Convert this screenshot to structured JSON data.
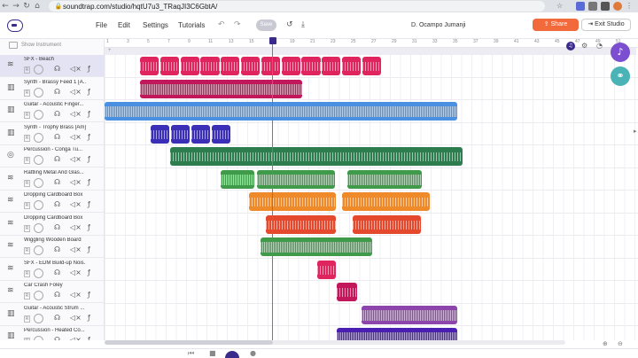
{
  "browser": {
    "url_host": "soundtrap.com",
    "url_path": "/studio/hqtU7u3_TRaqJI3C6GbtA/"
  },
  "header": {
    "menu": [
      "File",
      "Edit",
      "Settings",
      "Tutorials"
    ],
    "save_label": "Save",
    "user_name": "D. Ocampo Jumanji",
    "share_label": "Share",
    "exit_label": "Exit Studio"
  },
  "sidebar": {
    "show_instrument": "Show Instrument",
    "tracks": [
      {
        "name": "SFX - Beach",
        "icon": "waveform-icon"
      },
      {
        "name": "Synth - Brassy Feed 1 [A...",
        "icon": "keyboard-icon"
      },
      {
        "name": "Guitar - Acoustic Finger...",
        "icon": "keyboard-icon"
      },
      {
        "name": "Synth - Trophy Brass [Am]",
        "icon": "keyboard-icon"
      },
      {
        "name": "Percussion - Conga Tu...",
        "icon": "drum-icon"
      },
      {
        "name": "Rattling Metal And Glas...",
        "icon": "waveform-icon"
      },
      {
        "name": "Dropping Cardboard Box",
        "icon": "waveform-icon"
      },
      {
        "name": "Dropping Cardboard Box",
        "icon": "waveform-icon"
      },
      {
        "name": "Wiggling Wooden Board",
        "icon": "waveform-icon"
      },
      {
        "name": "SFX - EDM Build-up Nois...",
        "icon": "waveform-icon"
      },
      {
        "name": "Car Crash Foley",
        "icon": "waveform-icon"
      },
      {
        "name": "Guitar - Acoustic Strum ...",
        "icon": "keyboard-icon"
      },
      {
        "name": "Percussion - Heated Co...",
        "icon": "keyboard-icon"
      }
    ]
  },
  "ruler": {
    "ticks": [
      "1",
      "3",
      "5",
      "7",
      "9",
      "11",
      "13",
      "15",
      "17",
      "19",
      "21",
      "23",
      "25",
      "27",
      "29",
      "31",
      "33",
      "35",
      "37",
      "39",
      "41",
      "43",
      "45",
      "47",
      "49",
      "51"
    ]
  },
  "colors": {
    "accent": "#3a2a8c",
    "share": "#f26a3c",
    "fab_music": "#7b4fd0",
    "fab_collab": "#4ab3b6"
  }
}
